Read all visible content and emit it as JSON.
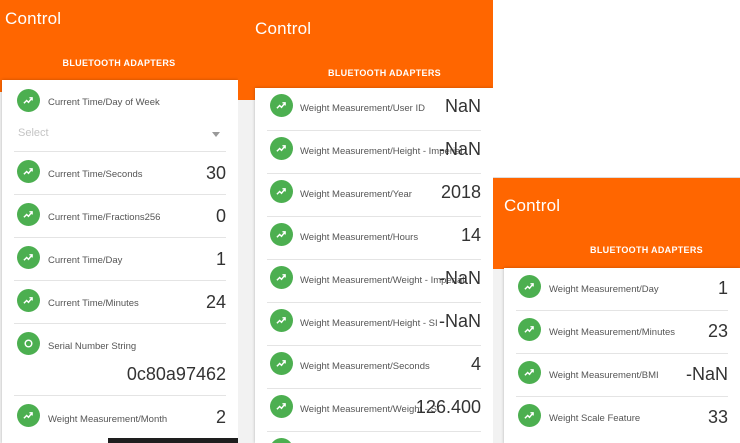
{
  "colors": {
    "header": "#ff6600",
    "badge": "#4caf50"
  },
  "icons": {
    "trend": "trending-up-icon",
    "circle": "circle-icon"
  },
  "screen1": {
    "title": "Control",
    "tab": "BLUETOOTH ADAPTERS",
    "header_row": {
      "label": "Current Time/Day of Week"
    },
    "select_placeholder": "Select",
    "rows": [
      {
        "label": "Current Time/Seconds",
        "value": "30"
      },
      {
        "label": "Current Time/Fractions256",
        "value": "0"
      },
      {
        "label": "Current Time/Day",
        "value": "1"
      },
      {
        "label": "Current Time/Minutes",
        "value": "24"
      }
    ],
    "serial": {
      "label": "Serial Number String",
      "value": "0c80a97462"
    },
    "last": {
      "label": "Weight Measurement/Month",
      "value": "2"
    }
  },
  "screen2": {
    "title": "Control",
    "tab": "BLUETOOTH ADAPTERS",
    "rows": [
      {
        "label": "Weight Measurement/User ID",
        "value": "NaN"
      },
      {
        "label": "Weight Measurement/Height - Imperial",
        "value": "-NaN"
      },
      {
        "label": "Weight Measurement/Year",
        "value": "2018"
      },
      {
        "label": "Weight Measurement/Hours",
        "value": "14"
      },
      {
        "label": "Weight Measurement/Weight - Imperial",
        "value": "-NaN"
      },
      {
        "label": "Weight Measurement/Height - SI",
        "value": "-NaN"
      },
      {
        "label": "Weight Measurement/Seconds",
        "value": "4"
      },
      {
        "label": "Weight Measurement/Weight - SI",
        "value": "126.400"
      }
    ]
  },
  "screen3": {
    "title": "Control",
    "tab": "BLUETOOTH ADAPTERS",
    "rows": [
      {
        "label": "Weight Measurement/Day",
        "value": "1"
      },
      {
        "label": "Weight Measurement/Minutes",
        "value": "23"
      },
      {
        "label": "Weight Measurement/BMI",
        "value": "-NaN"
      },
      {
        "label": "Weight Scale Feature",
        "value": "33"
      }
    ]
  }
}
